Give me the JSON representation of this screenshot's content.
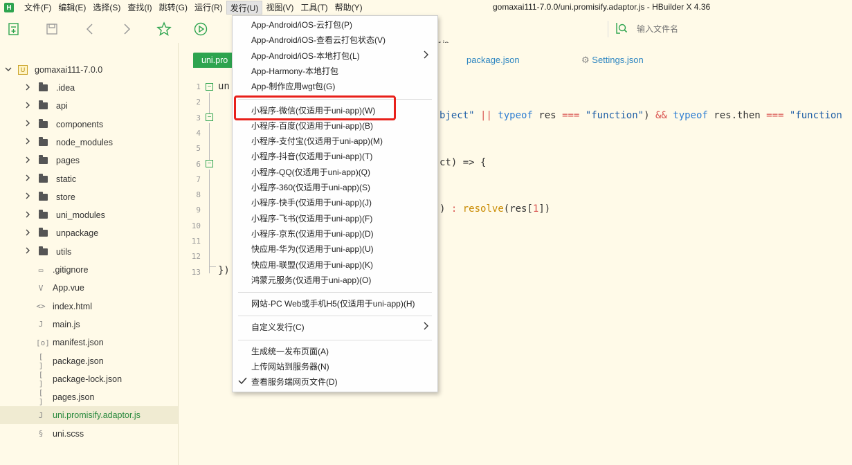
{
  "app": {
    "logo_letter": "H",
    "window_title": "gomaxai111-7.0.0/uni.promisify.adaptor.js - HBuilder X 4.36"
  },
  "menubar": {
    "items": [
      "文件(F)",
      "编辑(E)",
      "选择(S)",
      "查找(I)",
      "跳转(G)",
      "运行(R)",
      "发行(U)",
      "视图(V)",
      "工具(T)",
      "帮助(Y)"
    ],
    "active": "发行(U)"
  },
  "toolbar": {
    "search_placeholder": "输入文件名",
    "tab_snippet": "r.js"
  },
  "sidebar": {
    "project_name": "gomaxai111-7.0.0",
    "folders": [
      ".idea",
      "api",
      "components",
      "node_modules",
      "pages",
      "static",
      "store",
      "uni_modules",
      "unpackage",
      "utils"
    ],
    "files": [
      {
        "name": ".gitignore",
        "icon": "file-icon"
      },
      {
        "name": "App.vue",
        "icon": "vue-icon"
      },
      {
        "name": "index.html",
        "icon": "html-icon"
      },
      {
        "name": "main.js",
        "icon": "js-icon"
      },
      {
        "name": "manifest.json",
        "icon": "manifest-icon"
      },
      {
        "name": "package.json",
        "icon": "json-icon"
      },
      {
        "name": "package-lock.json",
        "icon": "json-icon"
      },
      {
        "name": "pages.json",
        "icon": "json-icon"
      },
      {
        "name": "uni.promisify.adaptor.js",
        "icon": "js-icon"
      },
      {
        "name": "uni.scss",
        "icon": "scss-icon"
      }
    ],
    "selected": "uni.promisify.adaptor.js"
  },
  "editor": {
    "active_tab": "uni.pro",
    "tabs": [
      "package.json",
      "Settings.json"
    ],
    "line_numbers": [
      "1",
      "2",
      "3",
      "4",
      "5",
      "6",
      "7",
      "8",
      "9",
      "10",
      "11",
      "12",
      "13"
    ],
    "code": {
      "line1": "un",
      "line3_a": "bject\"",
      "line3_b": "||",
      "line3_c": "typeof",
      "line3_d": "res",
      "line3_e": "===",
      "line3_f": "\"function\"",
      "line3_g": ")",
      "line3_h": "&&",
      "line3_i": "typeof",
      "line3_j": "res.then",
      "line3_k": "===",
      "line3_l": "\"function",
      "line6": "ct) => {",
      "line9_a": ")",
      "line9_b": ":",
      "line9_c": "resolve",
      "line9_d": "(res[",
      "line9_e": "1",
      "line9_f": "])",
      "line13": "})"
    }
  },
  "dropdown": {
    "group1": [
      "App-Android/iOS-云打包(P)",
      "App-Android/iOS-查看云打包状态(V)",
      "App-Android/iOS-本地打包(L)",
      "App-Harmony-本地打包",
      "App-制作应用wgt包(G)"
    ],
    "group2": [
      "小程序-微信(仅适用于uni-app)(W)",
      "小程序-百度(仅适用于uni-app)(B)",
      "小程序-支付宝(仅适用于uni-app)(M)",
      "小程序-抖音(仅适用于uni-app)(T)",
      "小程序-QQ(仅适用于uni-app)(Q)",
      "小程序-360(仅适用于uni-app)(S)",
      "小程序-快手(仅适用于uni-app)(J)",
      "小程序-飞书(仅适用于uni-app)(F)",
      "小程序-京东(仅适用于uni-app)(D)",
      "快应用-华为(仅适用于uni-app)(U)",
      "快应用-联盟(仅适用于uni-app)(K)",
      "鸿蒙元服务(仅适用于uni-app)(O)"
    ],
    "group3": [
      "网站-PC Web或手机H5(仅适用于uni-app)(H)"
    ],
    "group4": [
      "自定义发行(C)"
    ],
    "group5": [
      "生成统一发布页面(A)",
      "上传网站到服务器(N)",
      "查看服务端网页文件(D)"
    ],
    "checked_item": "查看服务端网页文件(D)",
    "highlighted_item": "小程序-微信(仅适用于uni-app)(W)"
  },
  "colors": {
    "accent": "#2ea44f",
    "highlight_border": "#e8201a",
    "background": "#fffae8"
  }
}
